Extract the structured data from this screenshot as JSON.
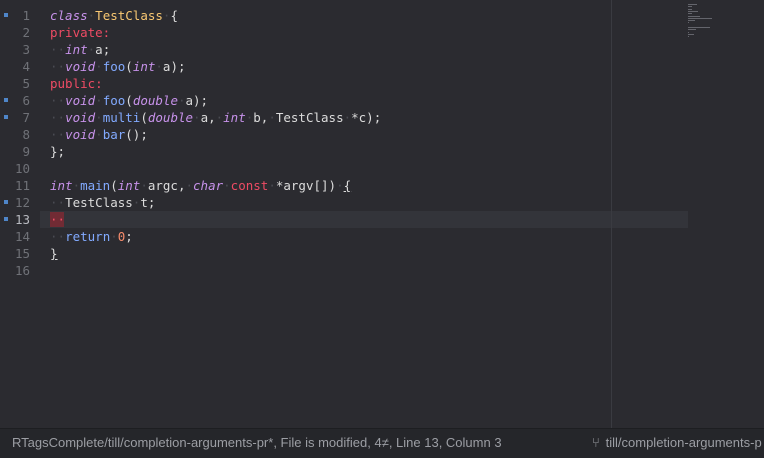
{
  "editor": {
    "lines": [
      {
        "num": "1",
        "tokens": [
          {
            "t": "class",
            "c": "#c792ea",
            "i": true
          },
          {
            "t": "·",
            "c": "ws"
          },
          {
            "t": "TestClass",
            "c": "#f9c872"
          },
          {
            "t": "·",
            "c": "ws"
          },
          {
            "t": "{",
            "c": "#dcdcdc"
          }
        ],
        "marker": true
      },
      {
        "num": "2",
        "tokens": [
          {
            "t": "private:",
            "c": "#ee4b64"
          }
        ]
      },
      {
        "num": "3",
        "tokens": [
          {
            "t": "··",
            "c": "ws"
          },
          {
            "t": "int",
            "c": "#c792ea",
            "i": true
          },
          {
            "t": "·",
            "c": "ws"
          },
          {
            "t": "a;",
            "c": "#dcdcdc"
          }
        ]
      },
      {
        "num": "4",
        "tokens": [
          {
            "t": "··",
            "c": "ws"
          },
          {
            "t": "void",
            "c": "#c792ea",
            "i": true
          },
          {
            "t": "·",
            "c": "ws"
          },
          {
            "t": "foo",
            "c": "#82aaff"
          },
          {
            "t": "(",
            "c": "#dcdcdc"
          },
          {
            "t": "int",
            "c": "#c792ea",
            "i": true
          },
          {
            "t": "·",
            "c": "ws"
          },
          {
            "t": "a);",
            "c": "#dcdcdc"
          }
        ]
      },
      {
        "num": "5",
        "tokens": [
          {
            "t": "public:",
            "c": "#ee4b64"
          }
        ]
      },
      {
        "num": "6",
        "tokens": [
          {
            "t": "··",
            "c": "ws"
          },
          {
            "t": "void",
            "c": "#c792ea",
            "i": true
          },
          {
            "t": "·",
            "c": "ws"
          },
          {
            "t": "foo",
            "c": "#82aaff"
          },
          {
            "t": "(",
            "c": "#dcdcdc"
          },
          {
            "t": "double",
            "c": "#c792ea",
            "i": true
          },
          {
            "t": "·",
            "c": "ws"
          },
          {
            "t": "a);",
            "c": "#dcdcdc"
          }
        ],
        "marker": true
      },
      {
        "num": "7",
        "tokens": [
          {
            "t": "··",
            "c": "ws"
          },
          {
            "t": "void",
            "c": "#c792ea",
            "i": true
          },
          {
            "t": "·",
            "c": "ws"
          },
          {
            "t": "multi",
            "c": "#82aaff"
          },
          {
            "t": "(",
            "c": "#dcdcdc"
          },
          {
            "t": "double",
            "c": "#c792ea",
            "i": true
          },
          {
            "t": "·",
            "c": "ws"
          },
          {
            "t": "a,",
            "c": "#dcdcdc"
          },
          {
            "t": "·",
            "c": "ws"
          },
          {
            "t": "int",
            "c": "#c792ea",
            "i": true
          },
          {
            "t": "·",
            "c": "ws"
          },
          {
            "t": "b,",
            "c": "#dcdcdc"
          },
          {
            "t": "·",
            "c": "ws"
          },
          {
            "t": "TestClass",
            "c": "#dcdcdc"
          },
          {
            "t": "·",
            "c": "ws"
          },
          {
            "t": "*c);",
            "c": "#dcdcdc"
          }
        ],
        "marker": true
      },
      {
        "num": "8",
        "tokens": [
          {
            "t": "··",
            "c": "ws"
          },
          {
            "t": "void",
            "c": "#c792ea",
            "i": true
          },
          {
            "t": "·",
            "c": "ws"
          },
          {
            "t": "bar",
            "c": "#82aaff"
          },
          {
            "t": "();",
            "c": "#dcdcdc"
          }
        ]
      },
      {
        "num": "9",
        "tokens": [
          {
            "t": "};",
            "c": "#dcdcdc"
          }
        ]
      },
      {
        "num": "10",
        "tokens": []
      },
      {
        "num": "11",
        "tokens": [
          {
            "t": "int",
            "c": "#c792ea",
            "i": true
          },
          {
            "t": "·",
            "c": "ws"
          },
          {
            "t": "main",
            "c": "#82aaff"
          },
          {
            "t": "(",
            "c": "#dcdcdc"
          },
          {
            "t": "int",
            "c": "#c792ea",
            "i": true
          },
          {
            "t": "·",
            "c": "ws"
          },
          {
            "t": "argc,",
            "c": "#dcdcdc"
          },
          {
            "t": "·",
            "c": "ws"
          },
          {
            "t": "char",
            "c": "#c792ea",
            "i": true
          },
          {
            "t": "·",
            "c": "ws"
          },
          {
            "t": "const",
            "c": "#ee4b64"
          },
          {
            "t": "·",
            "c": "ws"
          },
          {
            "t": "*argv[])",
            "c": "#dcdcdc"
          },
          {
            "t": "·",
            "c": "ws"
          },
          {
            "t": "{",
            "c": "#dcdcdc",
            "u": true
          }
        ]
      },
      {
        "num": "12",
        "tokens": [
          {
            "t": "··",
            "c": "ws"
          },
          {
            "t": "TestClass",
            "c": "#dcdcdc"
          },
          {
            "t": "·",
            "c": "ws"
          },
          {
            "t": "t;",
            "c": "#dcdcdc"
          }
        ],
        "marker": true
      },
      {
        "num": "13",
        "tokens": [
          {
            "t": "··",
            "c": "#ee4b64"
          }
        ],
        "marker": true,
        "current": true
      },
      {
        "num": "14",
        "tokens": [
          {
            "t": "··",
            "c": "ws"
          },
          {
            "t": "return",
            "c": "#82aaff"
          },
          {
            "t": "·",
            "c": "ws"
          },
          {
            "t": "0",
            "c": "#f78c6c"
          },
          {
            "t": ";",
            "c": "#dcdcdc"
          }
        ]
      },
      {
        "num": "15",
        "tokens": [
          {
            "t": "}",
            "c": "#dcdcdc",
            "u": true
          }
        ]
      },
      {
        "num": "16",
        "tokens": []
      }
    ]
  },
  "statusbar": {
    "text": "RTagsComplete/till/completion-arguments-pr*, File is modified, 4≠, Line 13, Column 3",
    "branch_icon": "git-branch-icon",
    "branch": "till/completion-arguments-p"
  },
  "colors": {
    "background": "#2b2b30",
    "current_line": "#33343a",
    "gutter_marker": "#4f86c9",
    "cursor_box": "#7d2a34"
  }
}
